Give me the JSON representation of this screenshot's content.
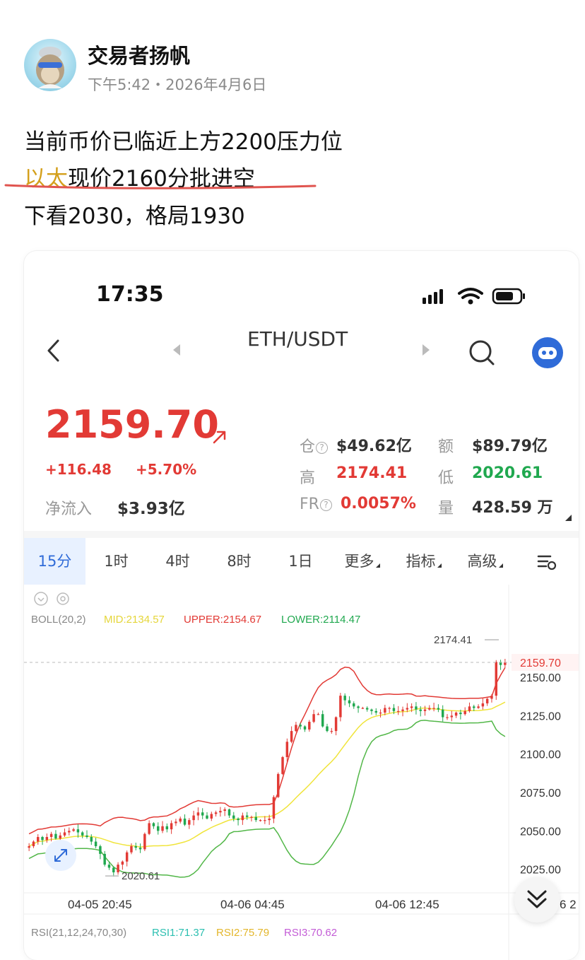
{
  "post": {
    "author": "交易者扬帆",
    "meta": "下午5:42・2026年4月6日",
    "line1": "当前币价已临近上方2200压力位",
    "line2_highlight": "以太",
    "line2_rest": "现价2160分批进空",
    "line3": "下看2030，格局1930"
  },
  "phone": {
    "time": "17:35",
    "pair": "ETH/USDT",
    "price": "2159.70",
    "change_abs": "+116.48",
    "change_pct": "+5.70%",
    "netflow_label": "净流入",
    "netflow_value": "$3.93亿",
    "stats": {
      "oi_label": "仓",
      "oi_value": "$49.62亿",
      "volume_amt_label": "额",
      "volume_amt_value": "$89.79亿",
      "high_label": "高",
      "high_value": "2174.41",
      "low_label": "低",
      "low_value": "2020.61",
      "fr_label": "FR",
      "fr_value": "0.0057%",
      "qty_label": "量",
      "qty_value": "428.59 万"
    },
    "tabs": [
      "15分",
      "1时",
      "4时",
      "8时",
      "1日",
      "更多",
      "指标",
      "高级"
    ],
    "active_tab": "15分"
  },
  "chart_data": {
    "type": "candlestick",
    "indicator": {
      "name": "BOLL(20,2)",
      "mid_label": "MID:2134.57",
      "upper_label": "UPPER:2154.67",
      "lower_label": "LOWER:2114.47"
    },
    "y_ticks": [
      "2150.00",
      "2125.00",
      "2100.00",
      "2075.00",
      "2050.00",
      "2025.00"
    ],
    "y_tick_values": [
      2150,
      2125,
      2100,
      2075,
      2050,
      2025
    ],
    "ylim": [
      2017,
      2185
    ],
    "current_price_label": "2159.70",
    "current_price": 2159.7,
    "high_label": "2174.41",
    "low_label": "2020.61",
    "x_labels": [
      "04-05 20:45",
      "04-06 04:45",
      "04-06 12:45"
    ],
    "x_label_partial": "6 2",
    "rsi_label": "RSI(21,12,24,70,30)",
    "rsi1": "RSI1:71.37",
    "rsi2": "RSI2:75.79",
    "rsi3": "RSI3:70.62",
    "colors": {
      "up": "#e23a35",
      "down": "#20a84f",
      "mid": "#f0e43a",
      "upper": "#e23a35",
      "lower": "#52b748"
    },
    "close": [
      2040,
      2043,
      2046,
      2044,
      2046,
      2048,
      2045,
      2047,
      2049,
      2050,
      2051,
      2049,
      2047,
      2046,
      2043,
      2040,
      2035,
      2028,
      2026,
      2023,
      2028,
      2030,
      2036,
      2040,
      2039,
      2038,
      2048,
      2055,
      2053,
      2050,
      2053,
      2051,
      2055,
      2056,
      2058,
      2054,
      2057,
      2060,
      2062,
      2060,
      2058,
      2061,
      2062,
      2063,
      2064,
      2060,
      2058,
      2057,
      2060,
      2059,
      2059,
      2057,
      2057,
      2057,
      2058,
      2072,
      2087,
      2098,
      2108,
      2115,
      2119,
      2118,
      2116,
      2121,
      2126,
      2126,
      2118,
      2115,
      2115,
      2124,
      2138,
      2135,
      2133,
      2131,
      2130,
      2130,
      2129,
      2128,
      2127,
      2127,
      2130,
      2130,
      2128,
      2128,
      2129,
      2130,
      2131,
      2129,
      2128,
      2129,
      2130,
      2130,
      2129,
      2124,
      2124,
      2125,
      2127,
      2126,
      2128,
      2131,
      2130,
      2131,
      2133,
      2136,
      2138,
      2160,
      2158,
      2159.7
    ]
  }
}
